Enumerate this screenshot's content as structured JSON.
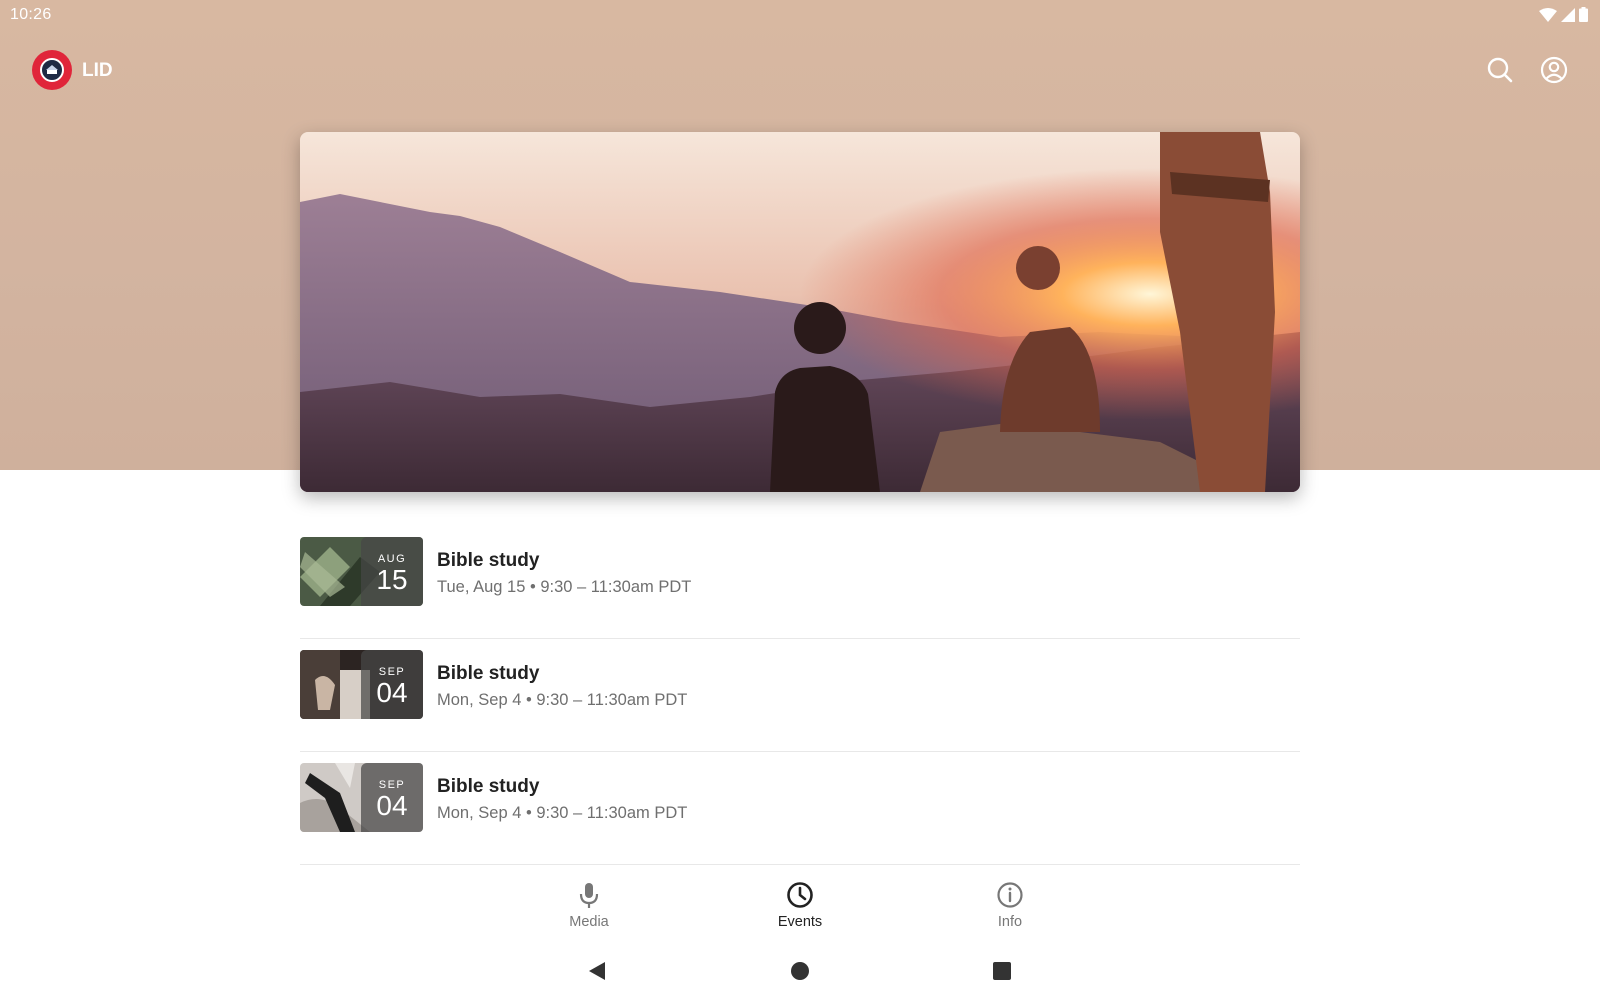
{
  "status_bar": {
    "time": "10:26",
    "icons": [
      "wifi-icon",
      "cell-signal-icon",
      "battery-icon"
    ]
  },
  "app_bar": {
    "title": "LID",
    "logo_color": "#e0253a",
    "actions": [
      "search-icon",
      "account-icon"
    ]
  },
  "theme": {
    "header_background": "#d6b6a0",
    "text_primary": "#222222",
    "text_secondary": "#6f6f6f"
  },
  "events": [
    {
      "title": "Bible study",
      "month": "AUG",
      "day": "15",
      "meta": "Tue, Aug 15 • 9:30 – 11:30am PDT"
    },
    {
      "title": "Bible study",
      "month": "SEP",
      "day": "04",
      "meta": "Mon, Sep 4 • 9:30 – 11:30am PDT"
    },
    {
      "title": "Bible study",
      "month": "SEP",
      "day": "04",
      "meta": "Mon, Sep 4 • 9:30 – 11:30am PDT"
    }
  ],
  "bottom_nav": {
    "selected": "Events",
    "items": [
      {
        "label": "Media",
        "icon": "microphone-icon"
      },
      {
        "label": "Events",
        "icon": "clock-icon"
      },
      {
        "label": "Info",
        "icon": "info-icon"
      }
    ]
  },
  "system_nav": [
    "back-icon",
    "home-icon",
    "recents-icon"
  ]
}
